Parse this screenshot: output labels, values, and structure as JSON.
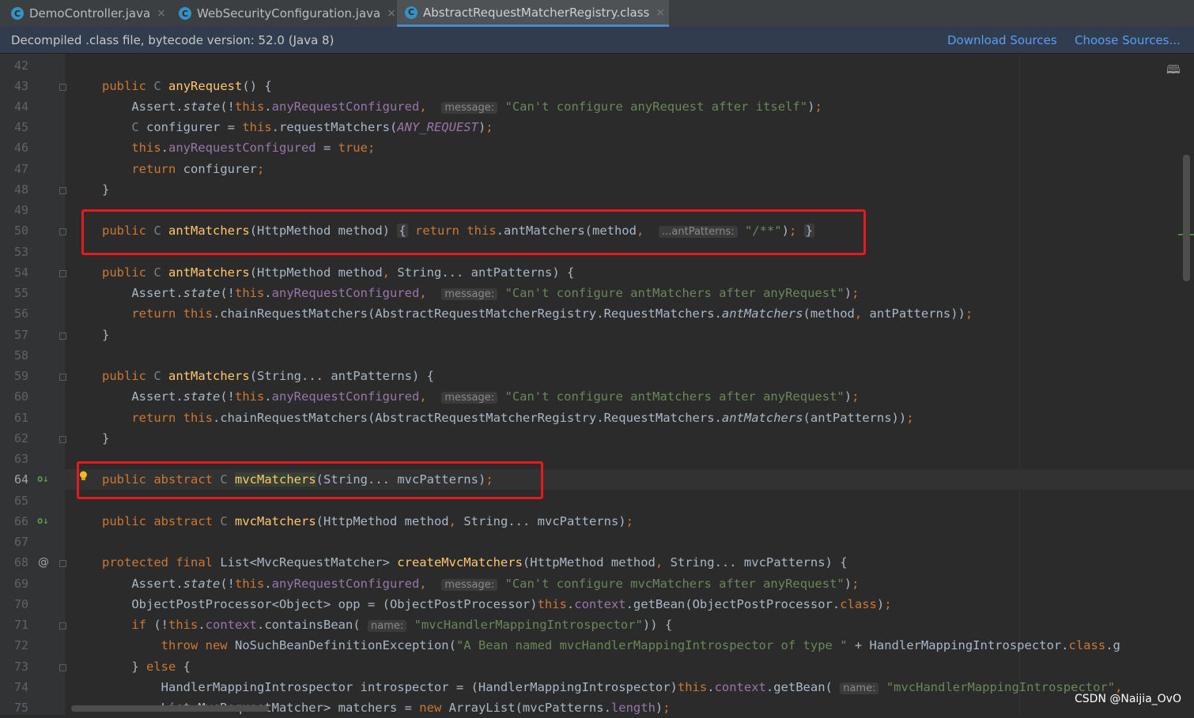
{
  "tabs": [
    {
      "label": "DemoController.java",
      "icon": "C",
      "active": false
    },
    {
      "label": "WebSecurityConfiguration.java",
      "icon": "C",
      "active": false
    },
    {
      "label": "AbstractRequestMatcherRegistry.class",
      "icon": "C",
      "active": true
    }
  ],
  "close_glyph": "×",
  "infobar": {
    "message": "Decompiled .class file, bytecode version: 52.0 (Java 8)",
    "download_sources": "Download Sources",
    "choose_sources": "Choose Sources..."
  },
  "line_numbers": [
    "42",
    "43",
    "44",
    "45",
    "46",
    "47",
    "48",
    "49",
    "50",
    "53",
    "54",
    "55",
    "56",
    "57",
    "58",
    "59",
    "60",
    "61",
    "62",
    "63",
    "64",
    "65",
    "66",
    "67",
    "68",
    "69",
    "70",
    "71",
    "72",
    "73",
    "74",
    "75"
  ],
  "current_line": "64",
  "hints": {
    "message": "message:",
    "ant_patterns": "...antPatterns:",
    "name": "name:"
  },
  "watermark": "CSDN @Naijia_OvO",
  "colors": {
    "keyword": "#cc7832",
    "method": "#ffc66d",
    "field": "#9876aa",
    "string": "#6a8759",
    "plain": "#a9b7c6",
    "highlight_box": "#e8191c"
  }
}
